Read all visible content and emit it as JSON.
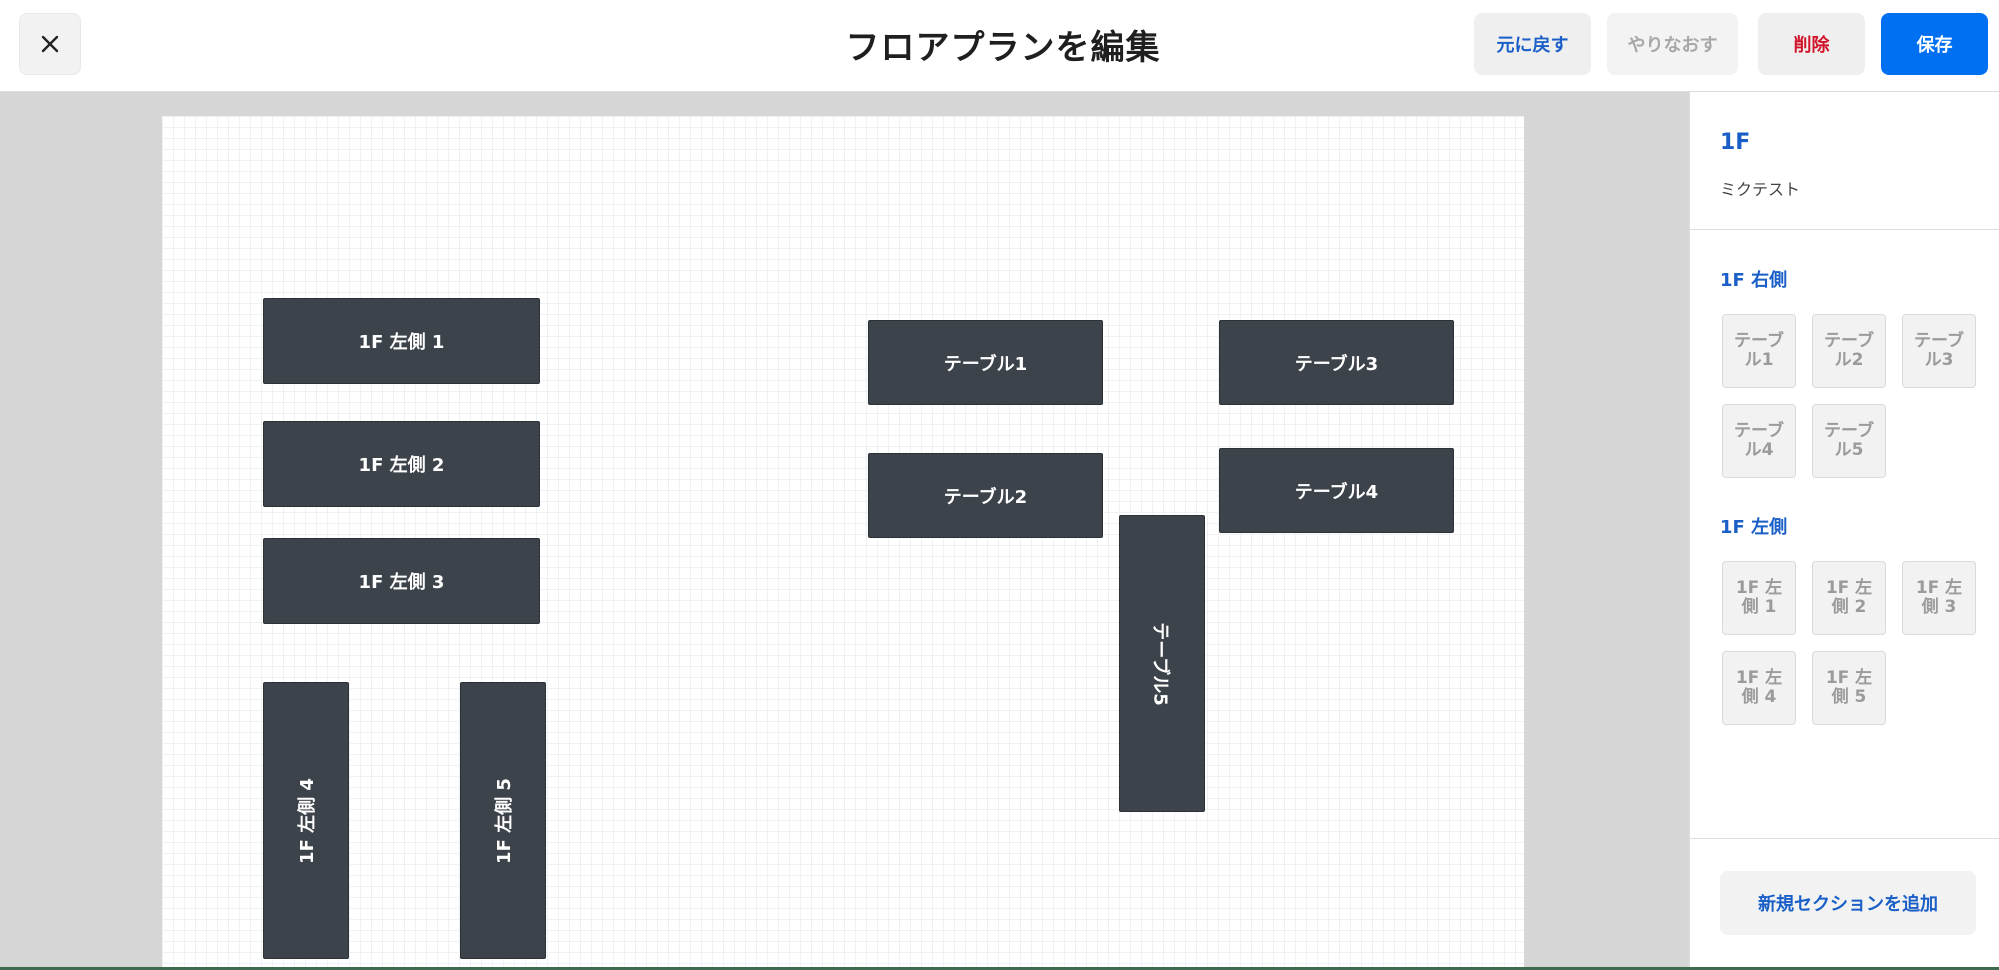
{
  "header": {
    "title": "フロアプランを編集",
    "undo_label": "元に戻す",
    "redo_label": "やりなおす",
    "delete_label": "削除",
    "save_label": "保存",
    "close_icon": "close-icon"
  },
  "canvas": {
    "tables": [
      {
        "label": "1F 左側 1"
      },
      {
        "label": "1F 左側 2"
      },
      {
        "label": "1F 左側 3"
      },
      {
        "label": "1F 左側 4"
      },
      {
        "label": "1F 左側 5"
      },
      {
        "label": "テーブル1"
      },
      {
        "label": "テーブル2"
      },
      {
        "label": "テーブル3"
      },
      {
        "label": "テーブル4"
      },
      {
        "label": "テーブル5"
      }
    ]
  },
  "sidebar": {
    "floor_name": "1F",
    "store_name": "ミクテスト",
    "sections": [
      {
        "title": "1F 右側",
        "tables": [
          "テーブル1",
          "テーブル2",
          "テーブル3",
          "テーブル4",
          "テーブル5"
        ]
      },
      {
        "title": "1F 左側",
        "tables": [
          "1F 左側 1",
          "1F 左側 2",
          "1F 左側 3",
          "1F 左側 4",
          "1F 左側 5"
        ]
      }
    ],
    "add_section_label": "新規セクションを追加"
  },
  "colors": {
    "accent": "#1a5fc7",
    "primary_button": "#0070f3",
    "danger": "#d0142a",
    "table_fill": "#3d434a",
    "canvas_background": "#d6d6d6"
  }
}
